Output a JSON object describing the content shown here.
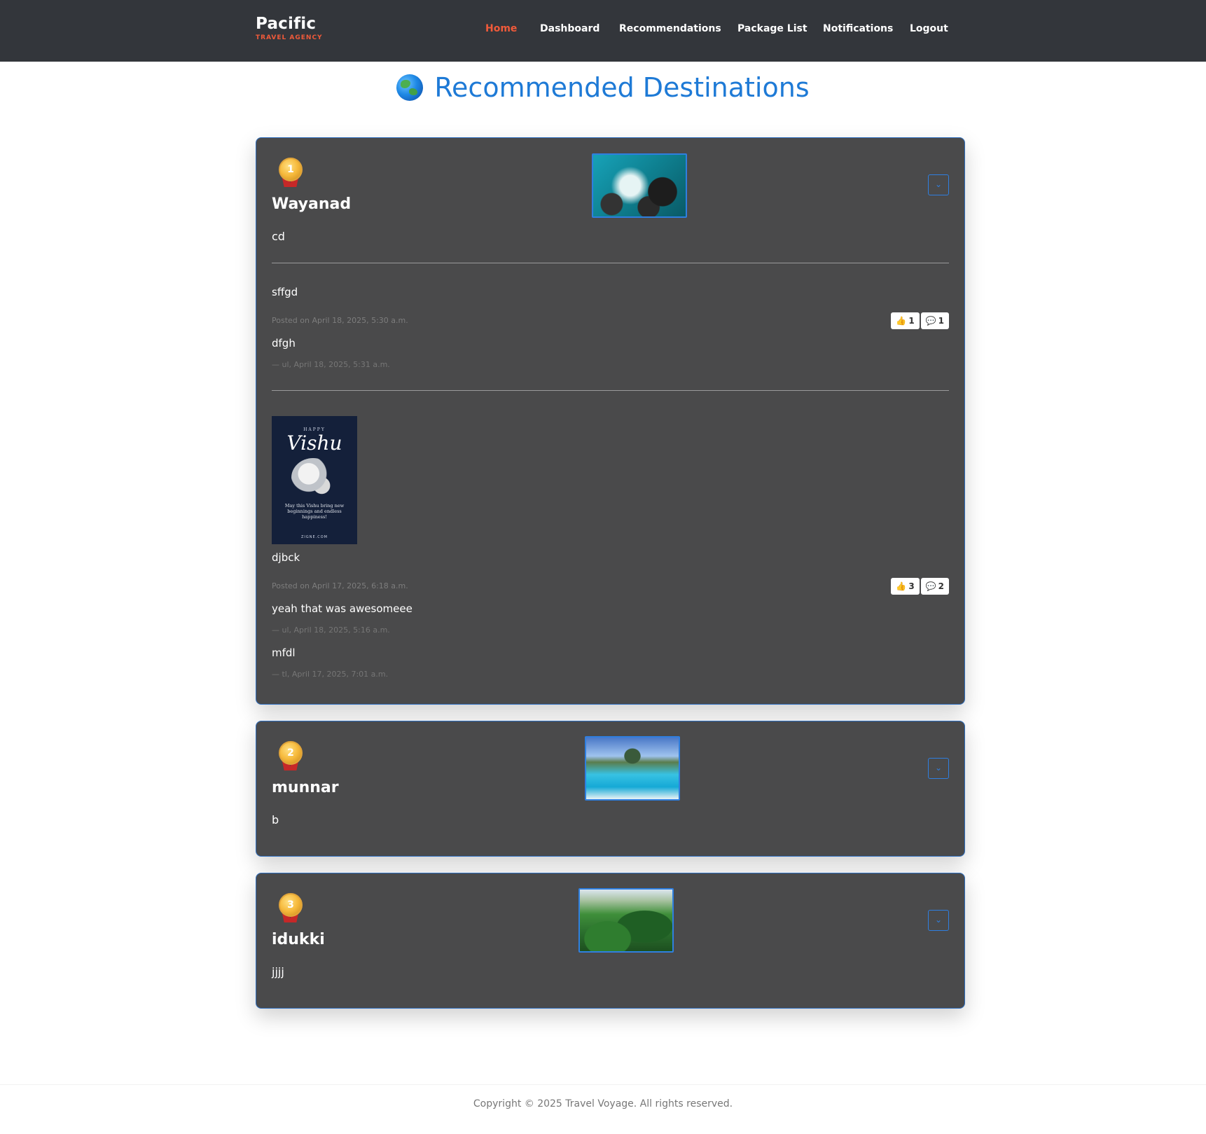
{
  "brand": {
    "name": "Pacific",
    "tagline": "TRAVEL AGENCY"
  },
  "nav": {
    "items": [
      {
        "label": "Home",
        "active": true
      },
      {
        "label": "Dashboard",
        "active": false
      },
      {
        "label": "Recommendations",
        "active": false
      },
      {
        "label": "Package List",
        "active": false
      },
      {
        "label": "Notifications",
        "active": false
      },
      {
        "label": "Logout",
        "active": false
      }
    ]
  },
  "page": {
    "title": "Recommended Destinations",
    "title_icon": "globe-icon"
  },
  "destinations": [
    {
      "rank": "1",
      "name": "Wayanad",
      "description": "cd",
      "thumbnail": "ocean-rocks-photo",
      "posts": [
        {
          "text": "sffgd",
          "meta": "Posted on April 18, 2025, 5:30 a.m.",
          "likes": "1",
          "comments_count": "1",
          "comments": [
            {
              "text": "dfgh",
              "meta": "— ul, April 18, 2025, 5:31 a.m."
            }
          ]
        },
        {
          "image": {
            "header": "HAPPY",
            "title": "Vishu",
            "message": "May this Vishu bring new beginnings and endless happiness!",
            "footer": "ZIGNE.COM"
          },
          "text": "djbck",
          "meta": "Posted on April 17, 2025, 6:18 a.m.",
          "likes": "3",
          "comments_count": "2",
          "comments": [
            {
              "text": "yeah that was awesomeee",
              "meta": "— ul, April 18, 2025, 5:16 a.m."
            },
            {
              "text": "mfdl",
              "meta": "— tl, April 17, 2025, 7:01 a.m."
            }
          ]
        }
      ]
    },
    {
      "rank": "2",
      "name": "munnar",
      "description": "b",
      "thumbnail": "overwater-bungalows-photo"
    },
    {
      "rank": "3",
      "name": "idukki",
      "description": "jjjj",
      "thumbnail": "green-hills-photo"
    }
  ],
  "footer": {
    "text": "Copyright © 2025 Travel Voyage. All rights reserved."
  },
  "colors": {
    "header_bg": "#33363b",
    "accent": "#f05a3a",
    "title_blue": "#1e7ad6",
    "card_bg": "#4a4a4b",
    "card_border": "#2f6fc0"
  }
}
